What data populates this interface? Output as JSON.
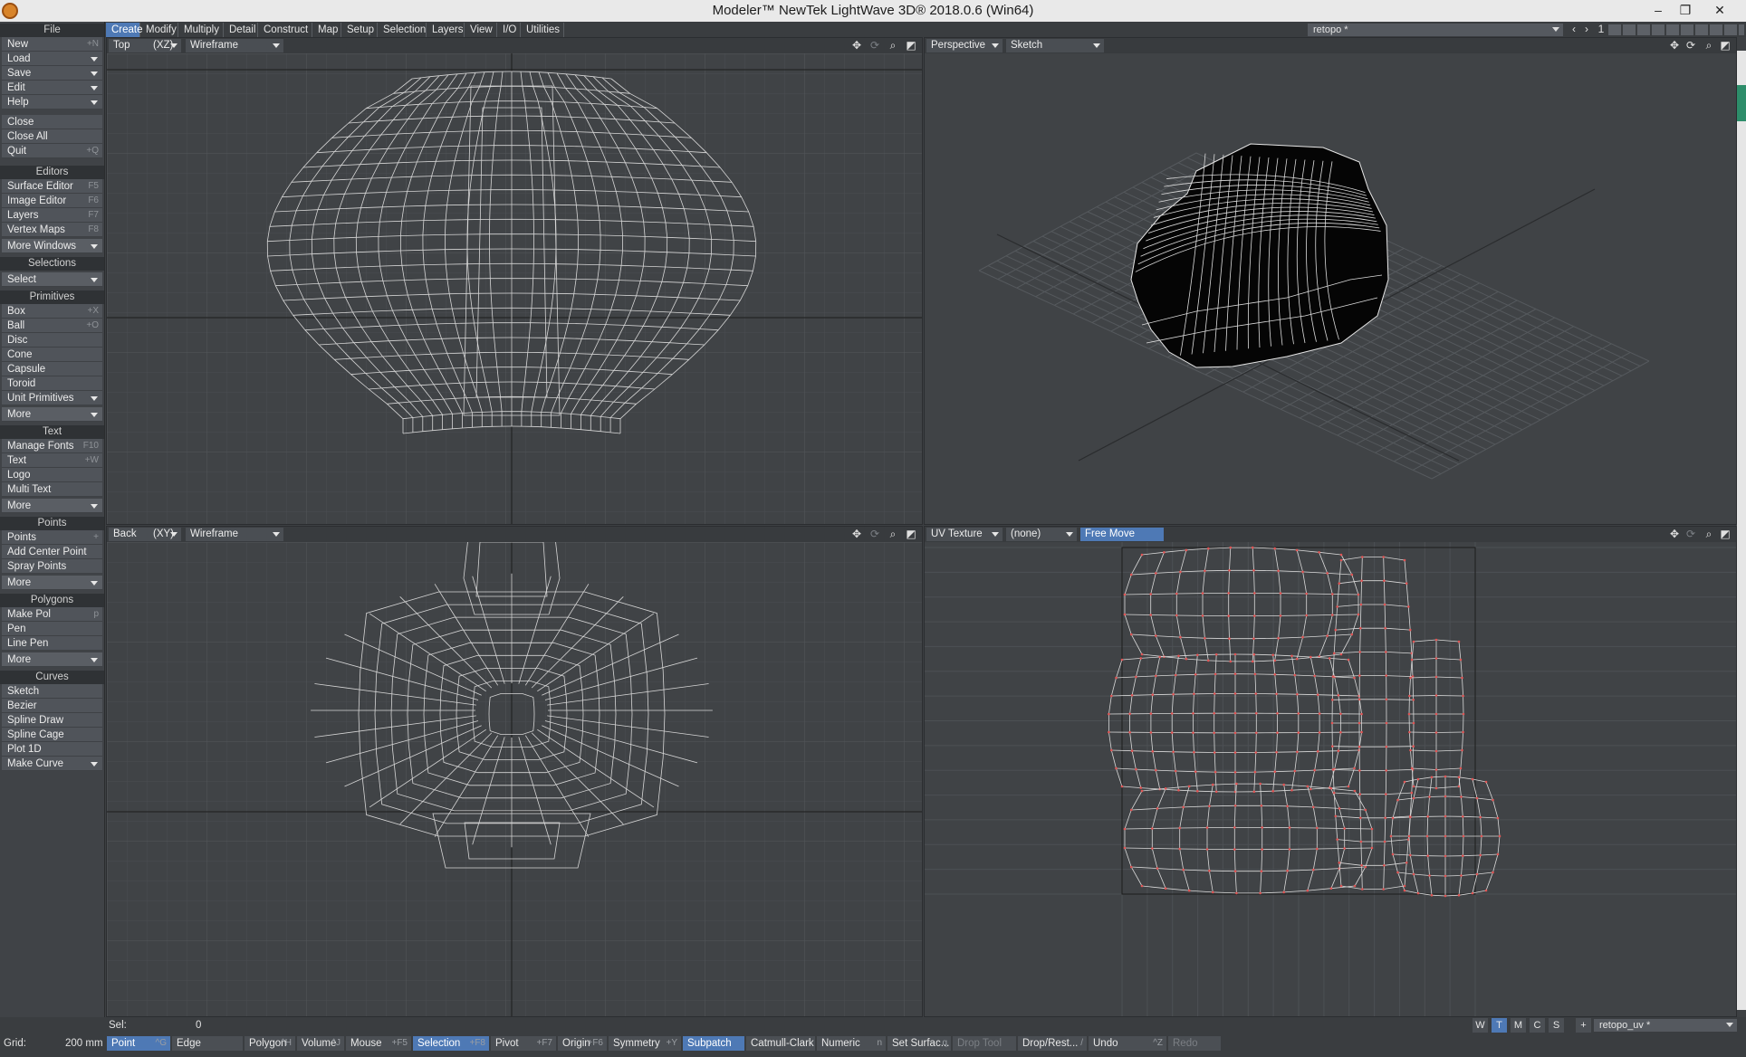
{
  "window": {
    "title": "Modeler™ NewTek LightWave 3D® 2018.0.6 (Win64)",
    "minimize": "–",
    "restore": "❐",
    "close": "✕"
  },
  "menu_tabs": [
    {
      "label": "Create",
      "active": true
    },
    {
      "label": "Modify"
    },
    {
      "label": "Multiply"
    },
    {
      "label": "Detail"
    },
    {
      "label": "Construct"
    },
    {
      "label": "Map"
    },
    {
      "label": "Setup"
    },
    {
      "label": "Selection"
    },
    {
      "label": "Layers"
    },
    {
      "label": "View"
    },
    {
      "label": "I/O"
    },
    {
      "label": "Utilities"
    }
  ],
  "object_selector": {
    "value": "retopo *"
  },
  "layer_number": "1",
  "left_panel": {
    "file_header": "File",
    "file_items": [
      {
        "label": "New",
        "shortcut": "+N"
      },
      {
        "label": "Load",
        "dropdown": true
      },
      {
        "label": "Save",
        "dropdown": true
      },
      {
        "label": "Edit",
        "dropdown": true
      },
      {
        "label": "Help",
        "dropdown": true
      }
    ],
    "file_items2": [
      {
        "label": "Close"
      },
      {
        "label": "Close All"
      },
      {
        "label": "Quit",
        "shortcut": "+Q"
      }
    ],
    "editors_header": "Editors",
    "editors_items": [
      {
        "label": "Surface Editor",
        "shortcut": "F5"
      },
      {
        "label": "Image Editor",
        "shortcut": "F6"
      },
      {
        "label": "Layers",
        "shortcut": "F7"
      },
      {
        "label": "Vertex Maps",
        "shortcut": "F8"
      }
    ],
    "more_windows": "More Windows",
    "selections_header": "Selections",
    "select": "Select",
    "primitives_header": "Primitives",
    "primitives_items": [
      {
        "label": "Box",
        "shortcut": "+X"
      },
      {
        "label": "Ball",
        "shortcut": "+O"
      },
      {
        "label": "Disc"
      },
      {
        "label": "Cone"
      },
      {
        "label": "Capsule"
      },
      {
        "label": "Toroid"
      },
      {
        "label": "Unit Primitives",
        "dropdown": true
      }
    ],
    "primitives_more": "More",
    "text_header": "Text",
    "text_items": [
      {
        "label": "Manage Fonts",
        "shortcut": "F10"
      },
      {
        "label": "Text",
        "shortcut": "+W"
      },
      {
        "label": "Logo"
      },
      {
        "label": "Multi Text"
      }
    ],
    "text_more": "More",
    "points_header": "Points",
    "points_items": [
      {
        "label": "Points",
        "shortcut": "+"
      },
      {
        "label": "Add Center Point"
      },
      {
        "label": "Spray Points"
      }
    ],
    "points_more": "More",
    "polygons_header": "Polygons",
    "polygons_items": [
      {
        "label": "Make Pol",
        "shortcut": "p"
      },
      {
        "label": "Pen"
      },
      {
        "label": "Line Pen"
      }
    ],
    "polygons_more": "More",
    "curves_header": "Curves",
    "curves_items": [
      {
        "label": "Sketch"
      },
      {
        "label": "Bezier"
      },
      {
        "label": "Spline Draw"
      },
      {
        "label": "Spline Cage"
      },
      {
        "label": "Plot 1D"
      },
      {
        "label": "Make Curve",
        "dropdown": true
      }
    ]
  },
  "viewports": {
    "top_left": {
      "view": "Top",
      "axes": "(XZ)",
      "mode": "Wireframe"
    },
    "top_right": {
      "view": "Perspective",
      "mode": "Sketch"
    },
    "bottom_left": {
      "view": "Back",
      "axes": "(XY)",
      "mode": "Wireframe"
    },
    "bottom_right": {
      "view": "UV Texture",
      "map": "(none)",
      "tool": "Free Move"
    }
  },
  "status": {
    "sel_label": "Sel:",
    "sel_value": "0",
    "grid_label": "Grid:",
    "grid_value": "200 mm",
    "view_modes": [
      "W",
      "T",
      "M",
      "C",
      "S"
    ],
    "active_view_mode": "T",
    "plus": "+",
    "uv_selector": "retopo_uv *",
    "buttons": [
      {
        "label": "Point",
        "shortcut": "^G",
        "active": true
      },
      {
        "label": "Edge",
        "shortcut": ""
      },
      {
        "label": "Polygon",
        "shortcut": "^H"
      },
      {
        "label": "Volume",
        "shortcut": "^J"
      },
      {
        "label": "Mouse",
        "shortcut": "+F5"
      },
      {
        "label": "Selection",
        "shortcut": "+F8",
        "active": true
      },
      {
        "label": "Pivot",
        "shortcut": "+F7"
      },
      {
        "label": "Origin",
        "shortcut": "+F6"
      },
      {
        "label": "Symmetry",
        "shortcut": "+Y"
      },
      {
        "label": "Subpatch",
        "shortcut": "",
        "active": true
      },
      {
        "label": "Catmull-Clark",
        "shortcut": ""
      },
      {
        "label": "Numeric",
        "shortcut": "n"
      },
      {
        "label": "Set Surfac...",
        "shortcut": "q"
      },
      {
        "label": "Drop Tool",
        "shortcut": "",
        "dim": true
      },
      {
        "label": "Drop/Rest...",
        "shortcut": "/"
      },
      {
        "label": "Undo",
        "shortcut": "^Z"
      },
      {
        "label": "Redo",
        "shortcut": "",
        "dim": true
      }
    ]
  },
  "colors": {
    "accent": "#4e79b5",
    "viewport_bg": "#404346",
    "wire": "#d8d8d8",
    "uv_point": "#e05555"
  }
}
